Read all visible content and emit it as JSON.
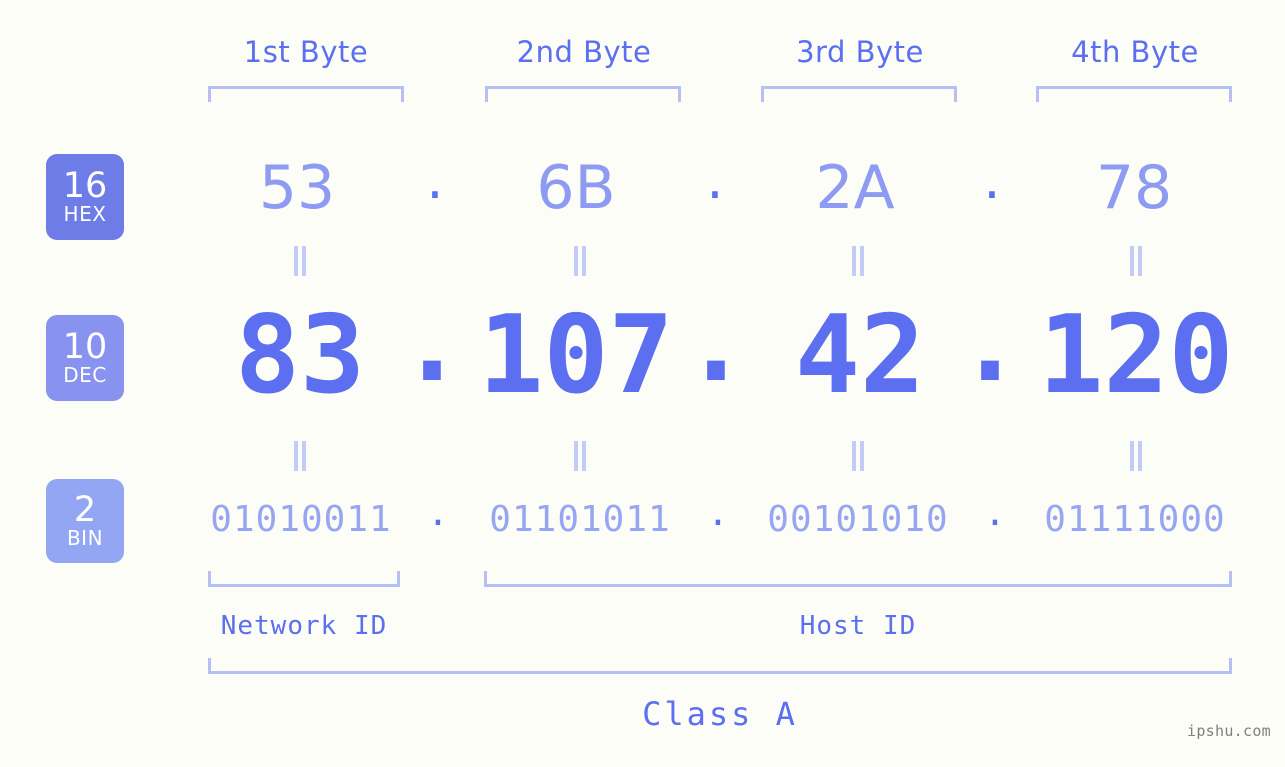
{
  "background_color": "#fdfdf7",
  "accent_color": "#5b6ff0",
  "muted_color": "#8d9bf2",
  "bracket_color": "#b6c0f5",
  "watermark": "ipshu.com",
  "byte_headers": [
    {
      "label": "1st Byte"
    },
    {
      "label": "2nd Byte"
    },
    {
      "label": "3rd Byte"
    },
    {
      "label": "4th Byte"
    }
  ],
  "bases": [
    {
      "number": "16",
      "name": "HEX",
      "color": "#6d7ce6"
    },
    {
      "number": "10",
      "name": "DEC",
      "color": "#8793ee"
    },
    {
      "number": "2",
      "name": "BIN",
      "color": "#93a6f4"
    }
  ],
  "separator": ".",
  "equals_symbol": "||",
  "rows": {
    "hex": {
      "values": [
        "53",
        "6B",
        "2A",
        "78"
      ]
    },
    "dec": {
      "values": [
        "83",
        "107",
        "42",
        "120"
      ]
    },
    "bin": {
      "values": [
        "01010011",
        "01101011",
        "00101010",
        "01111000"
      ]
    }
  },
  "ip_address": {
    "hex": "53.6B.2A.78",
    "dec": "83.107.42.120",
    "bin": "01010011.01101011.00101010.01111000"
  },
  "segments": {
    "network_id": "Network ID",
    "host_id": "Host ID",
    "class": "Class A"
  }
}
